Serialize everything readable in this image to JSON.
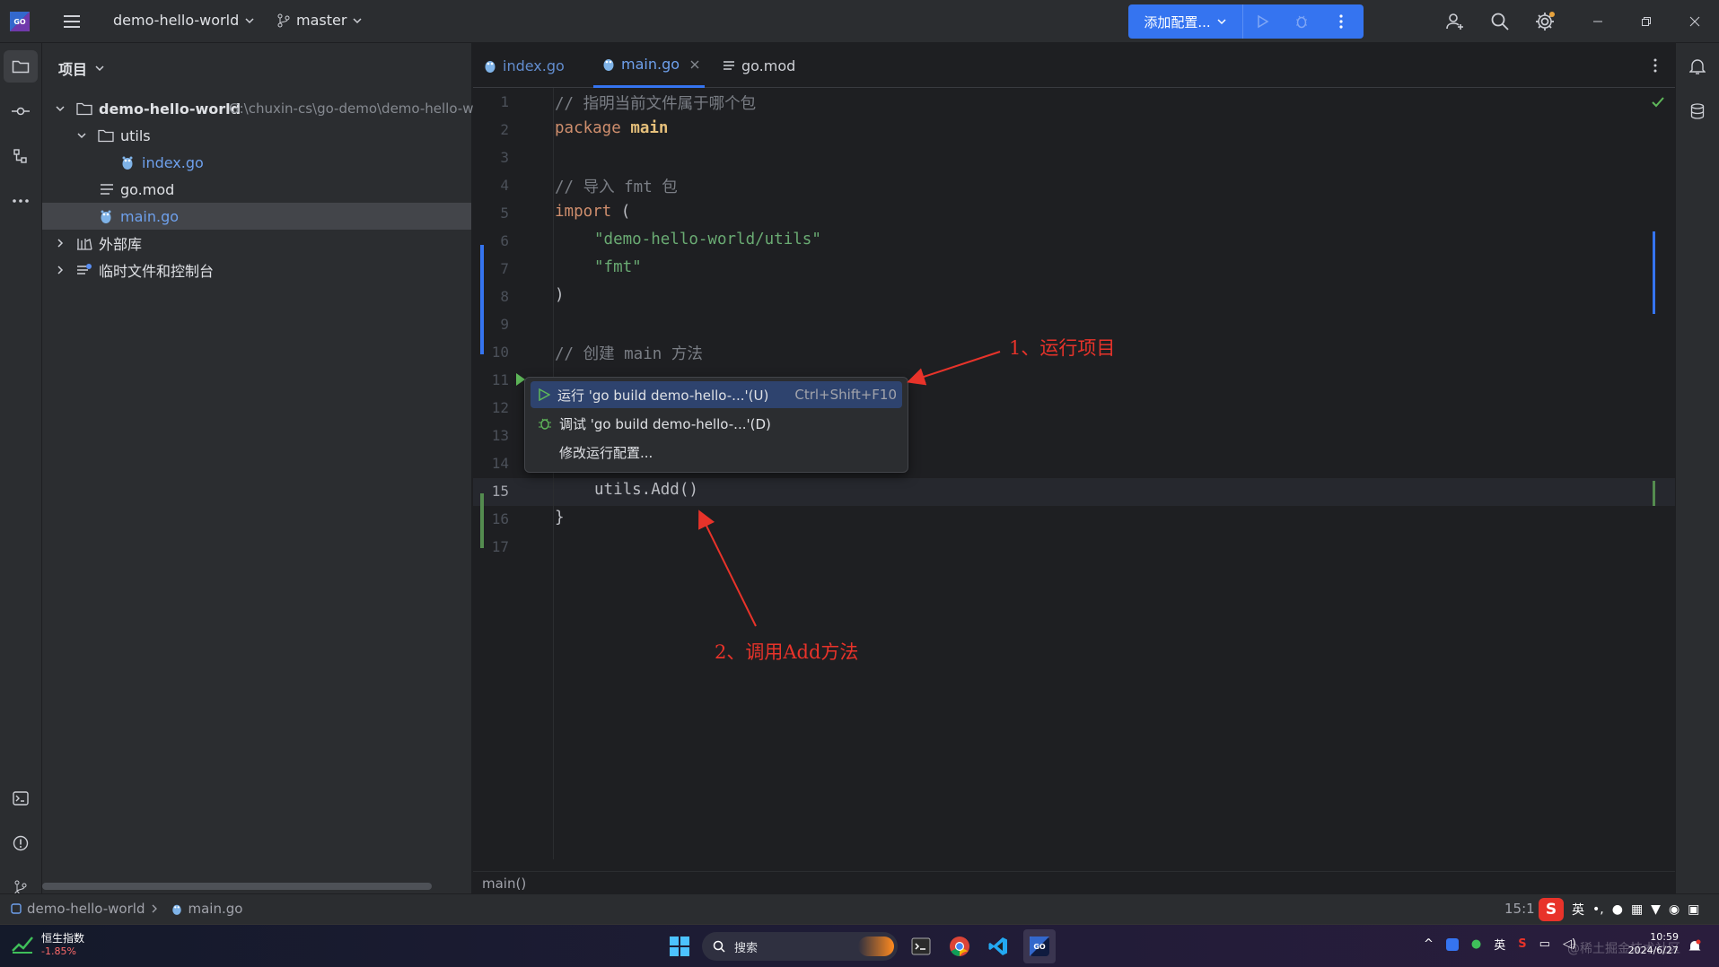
{
  "titlebar": {
    "project_name": "demo-hello-world",
    "branch": "master",
    "run_config_label": "添加配置..."
  },
  "project_panel": {
    "title": "项目",
    "tree": [
      {
        "label": "demo-hello-world",
        "path": "G:\\chuxin-cs\\go-demo\\demo-hello-w",
        "type": "folder",
        "expanded": true
      },
      {
        "label": "utils",
        "type": "folder",
        "expanded": true
      },
      {
        "label": "index.go",
        "type": "go-file"
      },
      {
        "label": "go.mod",
        "type": "mod-file"
      },
      {
        "label": "main.go",
        "type": "go-file",
        "selected": true
      },
      {
        "label": "外部库",
        "type": "library"
      },
      {
        "label": "临时文件和控制台",
        "type": "scratch"
      }
    ]
  },
  "editor": {
    "tabs": [
      {
        "label": "index.go",
        "active": false
      },
      {
        "label": "main.go",
        "active": true
      },
      {
        "label": "go.mod",
        "active": false
      }
    ],
    "line_numbers": [
      "1",
      "2",
      "3",
      "4",
      "5",
      "6",
      "7",
      "8",
      "9",
      "10",
      "11",
      "12",
      "13",
      "14",
      "15",
      "16",
      "17"
    ],
    "current_line": "15",
    "lines": {
      "l1": "// 指明当前文件属于哪个包",
      "l2_kw": "package",
      "l2_name": "main",
      "l4": "// 导入 fmt 包",
      "l5_kw": "import",
      "l5_rest": "(",
      "l6": "\"demo-hello-world/utils\"",
      "l7": "\"fmt\"",
      "l8": ")",
      "l10": "// 创建 main 方法",
      "l15": "utils.Add()",
      "l16": "}"
    },
    "breadcrumb_fn": "main()"
  },
  "context_menu": {
    "items": [
      {
        "label": "运行 'go build demo-hello-...'(U)",
        "shortcut": "Ctrl+Shift+F10"
      },
      {
        "label": "调试 'go build demo-hello-...'(D)",
        "shortcut": ""
      },
      {
        "label": "修改运行配置...",
        "shortcut": ""
      }
    ]
  },
  "annotations": {
    "run_project": "1、运行项目",
    "call_add": "2、调用Add方法"
  },
  "statusbar": {
    "project": "demo-hello-world",
    "file": "main.go",
    "position": "15:1"
  },
  "taskbar": {
    "stock_name": "恒生指数",
    "stock_change": "-1.85%",
    "search_placeholder": "搜索",
    "ime": "英",
    "time": "10:59",
    "date": "2024/6/27",
    "watermark": "@稀土掘金技术社区"
  },
  "colors": {
    "accent": "#3574f0",
    "annotation_red": "#e8332a",
    "keyword": "#cf8e6d",
    "string": "#6aab73",
    "comment": "#7a7e85"
  }
}
